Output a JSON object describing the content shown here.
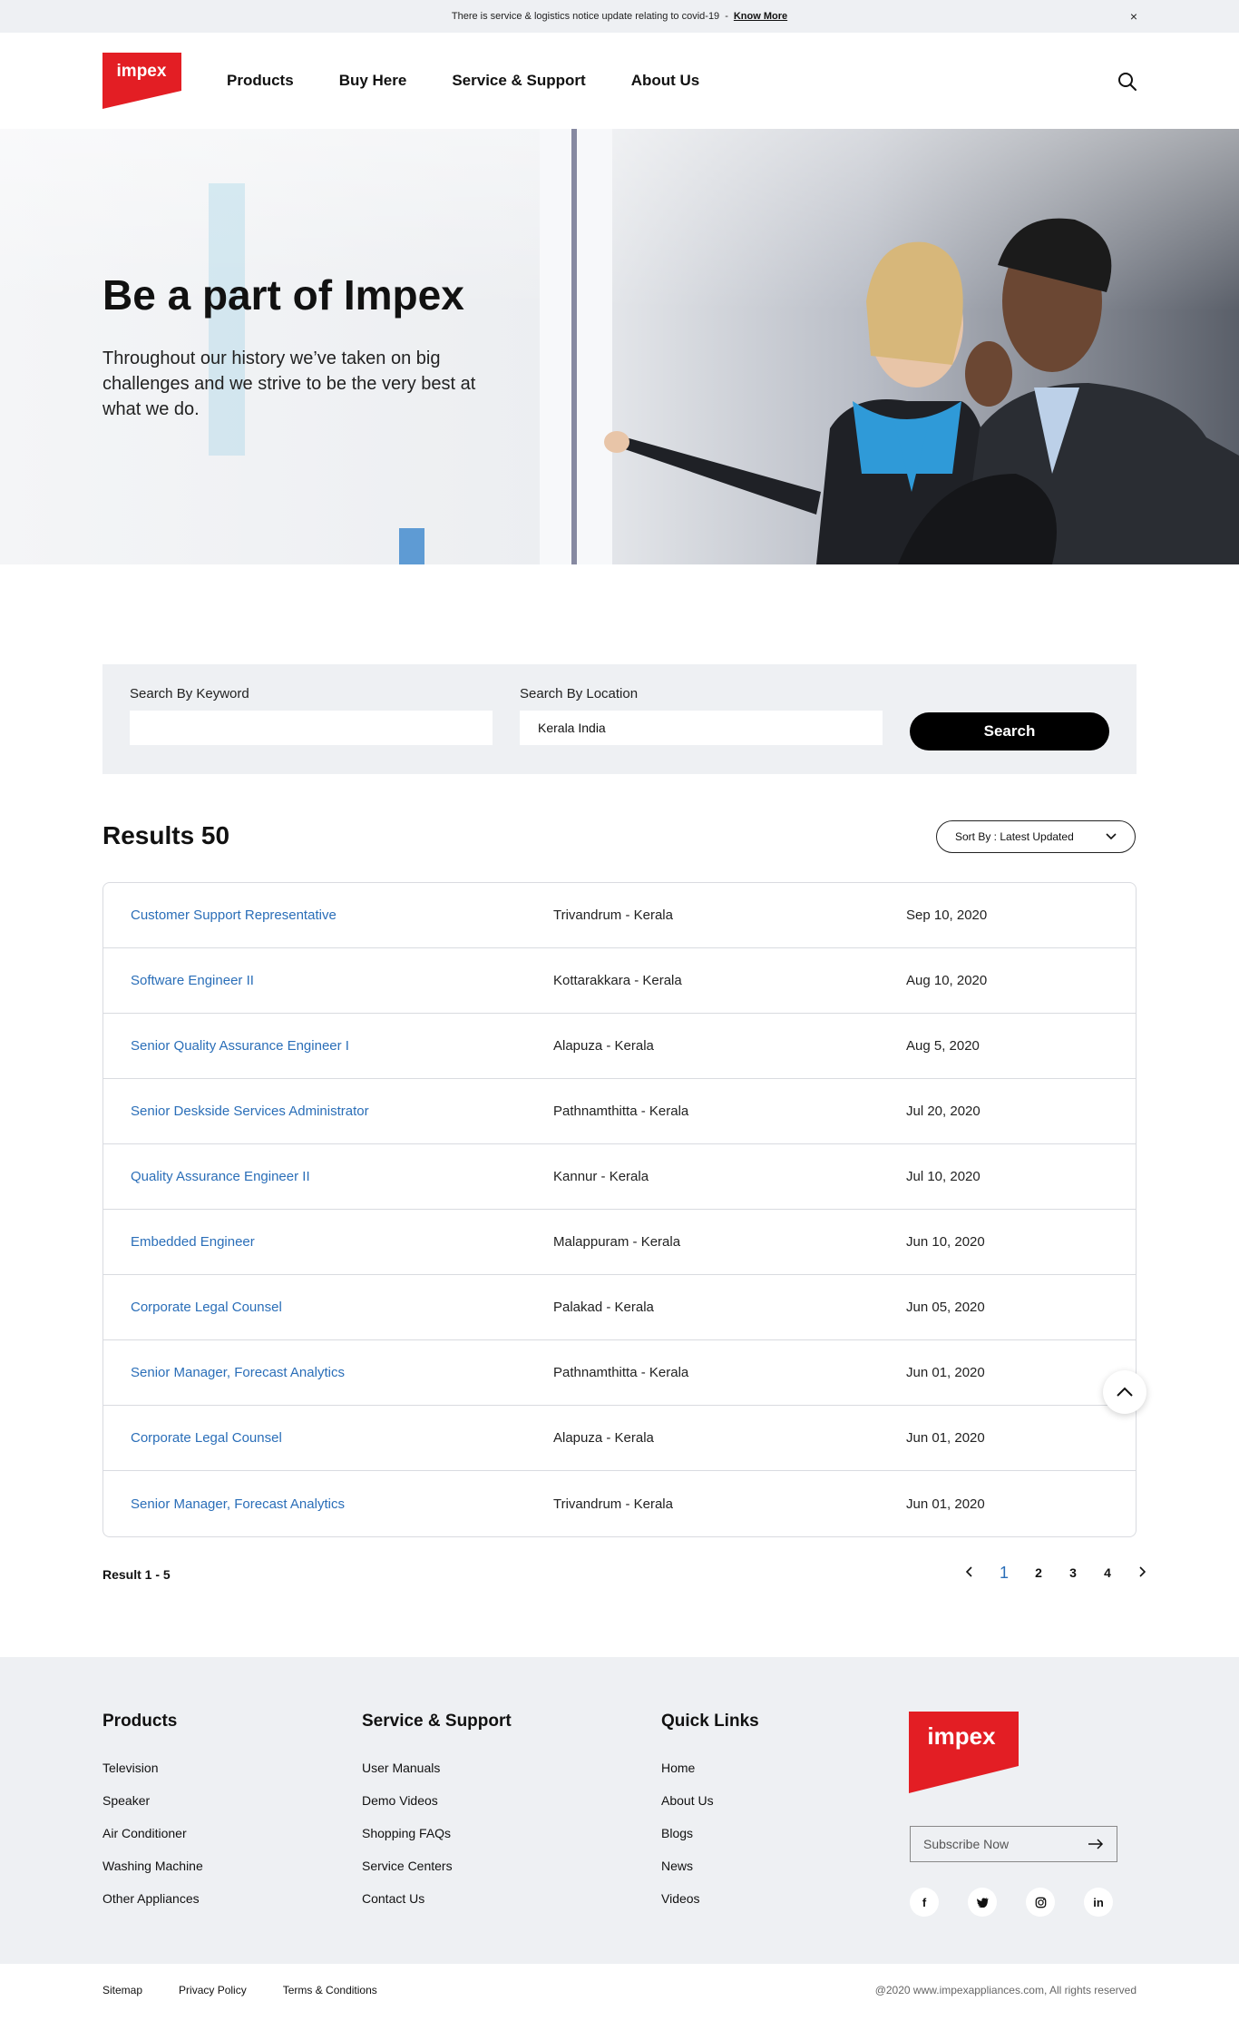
{
  "notice": {
    "text": "There is service & logistics notice update relating to covid-19",
    "separator": "-",
    "link": "Know More",
    "close": "×"
  },
  "brand": {
    "name": "impex",
    "color": "#e31e24"
  },
  "nav": {
    "items": [
      "Products",
      "Buy Here",
      "Service & Support",
      "About Us"
    ]
  },
  "hero": {
    "title": "Be a part of Impex",
    "description": "Throughout our history we’ve taken on big challenges and we strive to be the very best at what we do."
  },
  "search": {
    "keyword_label": "Search By Keyword",
    "keyword_value": "",
    "location_label": "Search By Location",
    "location_value": "Kerala India",
    "button": "Search"
  },
  "results": {
    "title": "Results 50",
    "sort_label": "Sort By : Latest Updated",
    "rows": [
      {
        "title": "Customer Support Representative",
        "location": "Trivandrum - Kerala",
        "date": "Sep 10, 2020"
      },
      {
        "title": "Software Engineer II",
        "location": "Kottarakkara - Kerala",
        "date": "Aug 10, 2020"
      },
      {
        "title": "Senior Quality Assurance Engineer I",
        "location": "Alapuza  - Kerala",
        "date": "Aug 5, 2020"
      },
      {
        "title": "Senior Deskside Services Administrator",
        "location": "Pathnamthitta  - Kerala",
        "date": "Jul 20, 2020"
      },
      {
        "title": "Quality Assurance Engineer II",
        "location": "Kannur - Kerala",
        "date": "Jul 10, 2020"
      },
      {
        "title": "Embedded Engineer",
        "location": "Malappuram - Kerala",
        "date": "Jun 10, 2020"
      },
      {
        "title": "Corporate Legal Counsel",
        "location": "Palakad - Kerala",
        "date": "Jun 05, 2020"
      },
      {
        "title": "Senior Manager, Forecast Analytics",
        "location": "Pathnamthitta  - Kerala",
        "date": "Jun 01, 2020"
      },
      {
        "title": "Corporate Legal Counsel",
        "location": "Alapuza  - Kerala",
        "date": "Jun 01, 2020"
      },
      {
        "title": "Senior Manager, Forecast Analytics",
        "location": "Trivandrum - Kerala",
        "date": "Jun 01, 2020"
      }
    ],
    "range": "Result 1 - 5",
    "pages": [
      "1",
      "2",
      "3",
      "4"
    ],
    "current_page": "1"
  },
  "footer": {
    "products": {
      "title": "Products",
      "links": [
        "Television",
        "Speaker",
        "Air Conditioner",
        "Washing Machine",
        "Other Appliances"
      ]
    },
    "service": {
      "title": "Service & Support",
      "links": [
        "User Manuals",
        "Demo Videos",
        "Shopping FAQs",
        "Service Centers",
        "Contact Us"
      ]
    },
    "quick": {
      "title": "Quick Links",
      "links": [
        "Home",
        "About Us",
        "Blogs",
        "News",
        "Videos"
      ]
    },
    "subscribe": "Subscribe Now",
    "socials": [
      {
        "name": "facebook-icon",
        "glyph": "f"
      },
      {
        "name": "twitter-icon",
        "glyph": "🐦"
      },
      {
        "name": "instagram-icon",
        "glyph": "◎"
      },
      {
        "name": "linkedin-icon",
        "glyph": "in"
      }
    ]
  },
  "bottom": {
    "links": [
      "Sitemap",
      "Privacy Policy",
      "Terms & Conditions"
    ],
    "copyright": "@2020 www.impexappliances.com, All rights reserved"
  }
}
